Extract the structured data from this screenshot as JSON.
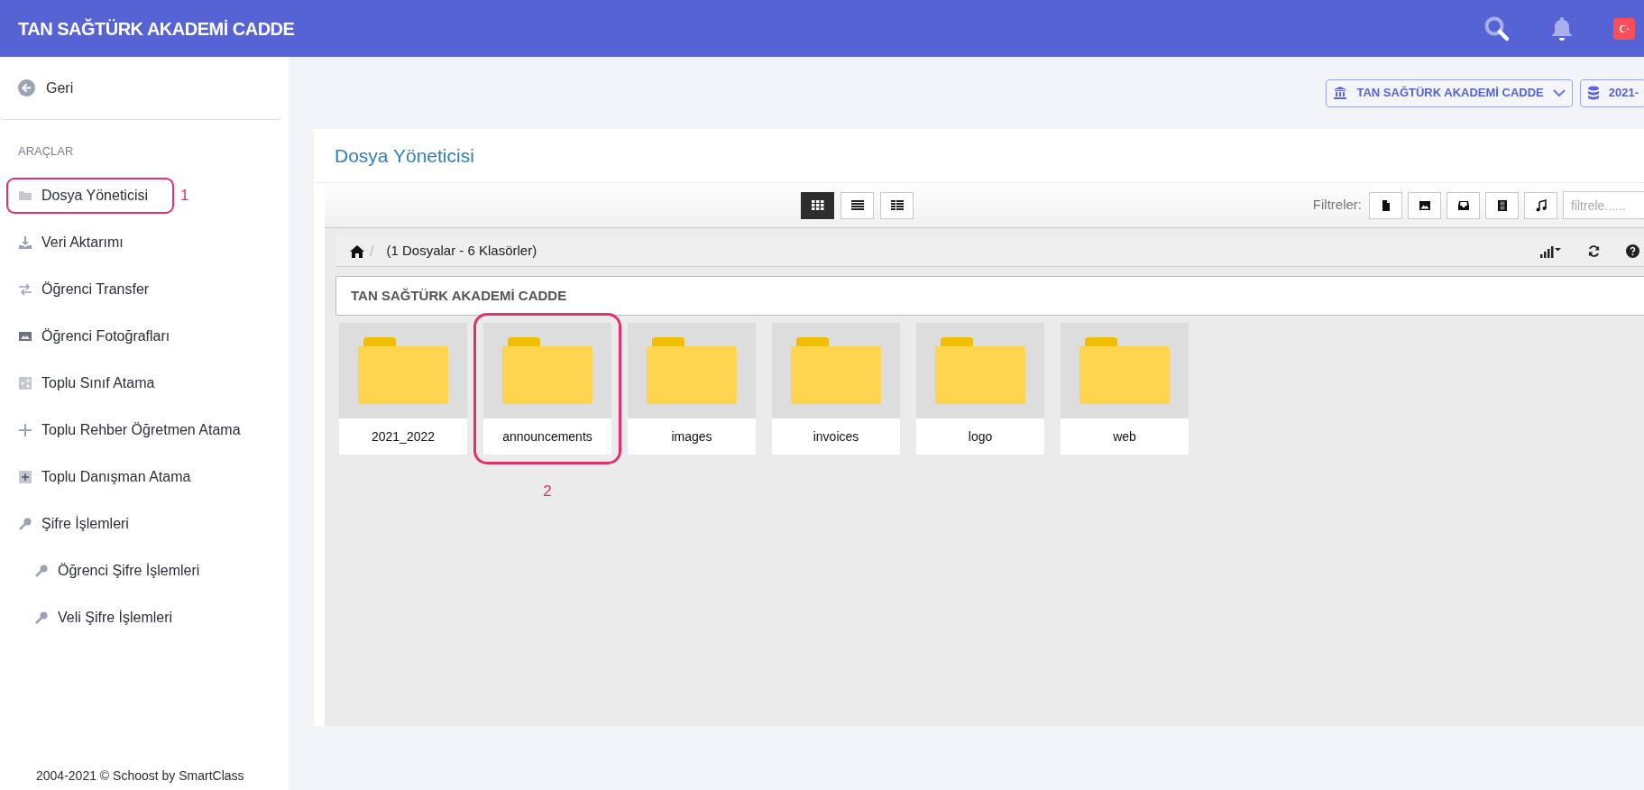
{
  "header": {
    "title": "TAN SAĞTÜRK AKADEMİ CADDE"
  },
  "sidebar": {
    "back": "Geri",
    "section": "ARAÇLAR",
    "items": [
      {
        "kind": "folder",
        "label": "Dosya Yöneticisi",
        "annotation": "1"
      },
      {
        "kind": "download",
        "label": "Veri Aktarımı"
      },
      {
        "kind": "transfer",
        "label": "Öğrenci Transfer"
      },
      {
        "kind": "image",
        "label": "Öğrenci Fotoğrafları"
      },
      {
        "kind": "share",
        "label": "Toplu Sınıf Atama"
      },
      {
        "kind": "plus",
        "label": "Toplu Rehber Öğretmen Atama"
      },
      {
        "kind": "plusbox",
        "label": "Toplu Danışman Atama"
      },
      {
        "kind": "key",
        "label": "Şifre İşlemleri",
        "children": [
          {
            "kind": "key",
            "label": "Öğrenci Şifre İşlemleri"
          },
          {
            "kind": "key",
            "label": "Veli Şifre İşlemleri"
          }
        ]
      }
    ],
    "footer": "2004-2021 © Schoost by SmartClass"
  },
  "selectors": [
    {
      "kind": "school",
      "label": "TAN SAĞTÜRK AKADEMİ CADDE"
    },
    {
      "kind": "database",
      "label": "2021-"
    }
  ],
  "file_manager": {
    "title": "Dosya Yöneticisi",
    "views": [
      {
        "kind": "grid",
        "selected": true
      },
      {
        "kind": "list",
        "selected": false
      },
      {
        "kind": "details",
        "selected": false
      }
    ],
    "filters_label": "Filtreler:",
    "filters": [
      {
        "kind": "file"
      },
      {
        "kind": "image"
      },
      {
        "kind": "archive"
      },
      {
        "kind": "video"
      },
      {
        "kind": "audio"
      }
    ],
    "filter_placeholder": "filtrele......",
    "breadcrumb_separator": "/",
    "breadcrumb": "(1 Dosyalar - 6 Klasörler)",
    "folder_title": "TAN SAĞTÜRK AKADEMİ CADDE",
    "folders": [
      {
        "name": "2021_2022"
      },
      {
        "name": "announcements",
        "annotation": "2"
      },
      {
        "name": "images"
      },
      {
        "name": "invoices"
      },
      {
        "name": "logo"
      },
      {
        "name": "web"
      }
    ]
  }
}
